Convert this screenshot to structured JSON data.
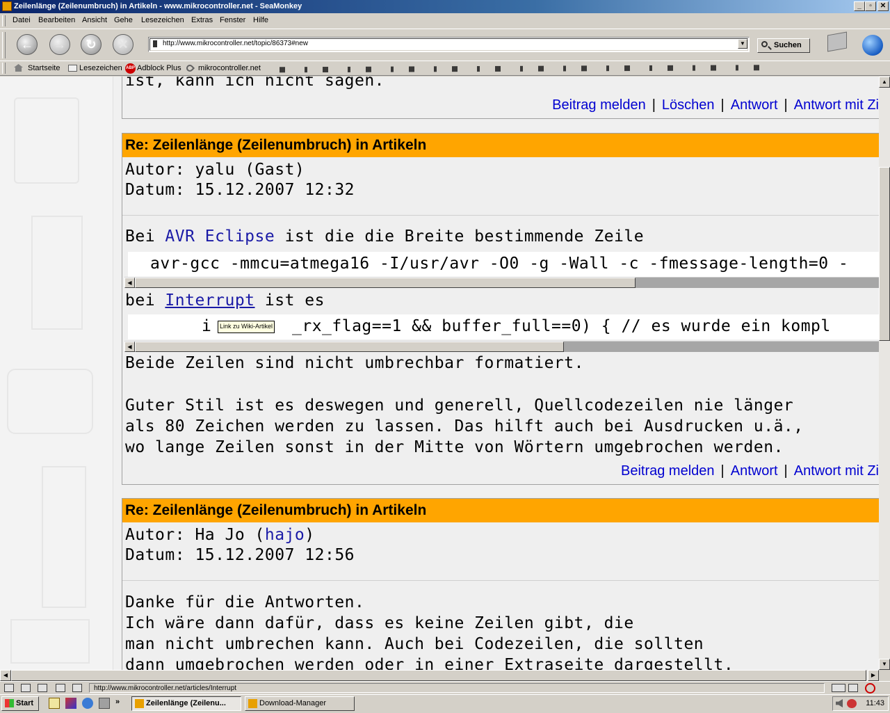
{
  "window": {
    "title": "Zeilenlänge (Zeilenumbruch) in Artikeln - www.mikrocontroller.net - SeaMonkey",
    "minimize": "_",
    "maximize": "▫",
    "close": "✕"
  },
  "menu": [
    "Datei",
    "Bearbeiten",
    "Ansicht",
    "Gehe",
    "Lesezeichen",
    "Extras",
    "Fenster",
    "Hilfe"
  ],
  "navigation": {
    "url": "http://www.mikrocontroller.net/topic/86373#new",
    "search_label": "Suchen"
  },
  "bookmarks": [
    "Startseite",
    "Lesezeichen",
    "Adblock Plus",
    "mikrocontroller.net"
  ],
  "posts": [
    {
      "tail_text": "ist, kann ich nicht sagen.",
      "actions": [
        "Beitrag melden",
        "Löschen",
        "Antwort",
        "Antwort mit Zi"
      ]
    },
    {
      "title": "Re: Zeilenlänge (Zeilenumbruch) in Artikeln",
      "author_label": "Autor:",
      "author": "yalu (Gast)",
      "date_label": "Datum:",
      "date": "15.12.2007 12:32",
      "p1_prefix": "Bei",
      "p1_link": "AVR Eclipse",
      "p1_suffix": "ist die die Breite bestimmende Zeile",
      "code1": "avr-gcc -mmcu=atmega16 -I/usr/avr -O0 -g -Wall -c -fmessage-length=0 -",
      "p2_prefix": "bei",
      "p2_link": "Interrupt",
      "p2_suffix": "ist es",
      "code2_a": "i",
      "code2_b": "_rx_flag==1 && buffer_full==0) {     // es wurde ein kompl",
      "tooltip": "Link zu Wiki-Artikel",
      "p3": "Beide Zeilen sind nicht umbrechbar formatiert.",
      "p4": [
        "Guter Stil ist es deswegen und generell, Quellcodezeilen nie länger",
        "als 80 Zeichen werden zu lassen. Das hilft auch bei Ausdrucken u.ä.,",
        "wo lange Zeilen sonst in der Mitte von Wörtern umgebrochen werden."
      ],
      "actions": [
        "Beitrag melden",
        "Antwort",
        "Antwort mit Zi"
      ]
    },
    {
      "title": "Re: Zeilenlänge (Zeilenumbruch) in Artikeln",
      "author_label": "Autor:",
      "author_prefix": "Ha Jo (",
      "author_link": "hajo",
      "author_suffix": ")",
      "date_label": "Datum:",
      "date": "15.12.2007 12:56",
      "lines": [
        "Danke für die Antworten.",
        "Ich wäre dann dafür, dass es keine Zeilen gibt, die",
        "man nicht umbrechen kann. Auch bei Codezeilen, die sollten",
        "dann umgebrochen werden oder in einer Extraseite dargestellt."
      ]
    }
  ],
  "status": {
    "text": "http://www.mikrocontroller.net/articles/Interrupt"
  },
  "taskbar": {
    "start": "Start",
    "tasks": [
      "Zeilenlänge (Zeilenu...",
      "Download-Manager"
    ],
    "clock": "11:43"
  },
  "colors": {
    "post_header": "#ffa500",
    "link": "#1a1aa6",
    "action_link": "#0000d0"
  }
}
